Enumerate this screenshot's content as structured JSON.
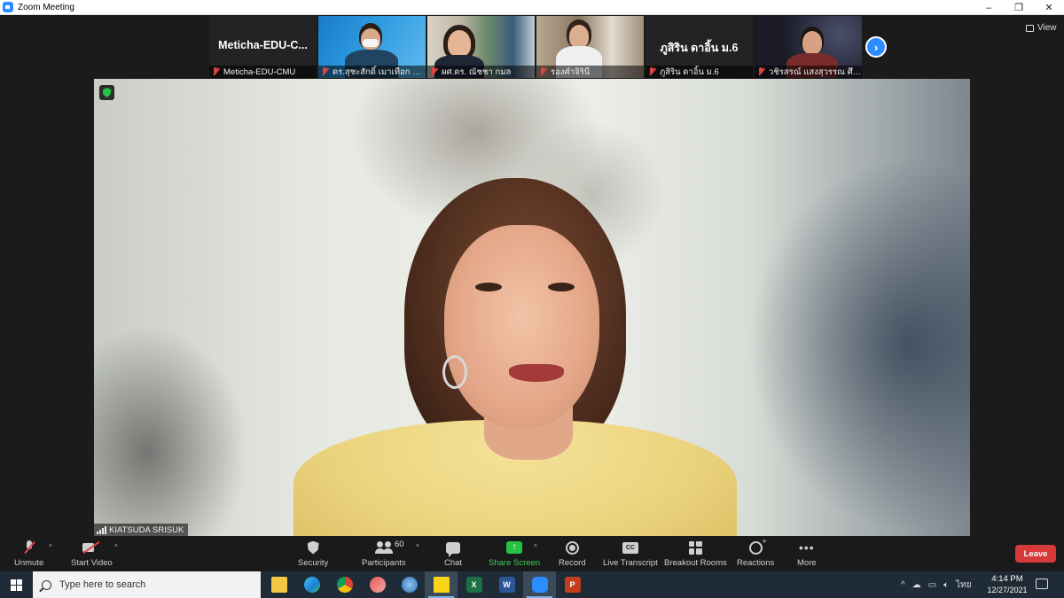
{
  "window": {
    "title": "Zoom Meeting",
    "controls": [
      "–",
      "❐",
      "✕"
    ]
  },
  "view_button": {
    "label": "View"
  },
  "thumbnails": [
    {
      "name": "Meticha-EDU-CMU",
      "display_name": "Meticha-EDU-C...",
      "muted": true,
      "video": false
    },
    {
      "name": "ดร.สุชะสักดิ์ เมาเทือก มห...",
      "muted": true,
      "video": true
    },
    {
      "name": "ผศ.ดร. ณัชชา กมล",
      "muted": true,
      "video": true
    },
    {
      "name": "รองคำจิรินี",
      "muted": true,
      "video": true
    },
    {
      "name": "ภูสิริน ดาอิ้น ม.6",
      "display_name": "ภูสิริน ดาอิ้น ม.6",
      "muted": true,
      "video": false
    },
    {
      "name": "วชิรสรณ์ แสงสุวรรณ ศึก...",
      "muted": true,
      "video": true
    }
  ],
  "speaker": {
    "name": "KIATSUDA SRISUK"
  },
  "toolbar": {
    "unmute": "Unmute",
    "start_video": "Start Video",
    "security": "Security",
    "participants": "Participants",
    "participants_count": "60",
    "chat": "Chat",
    "share_screen": "Share Screen",
    "record": "Record",
    "live_transcript": "Live Transcript",
    "breakout_rooms": "Breakout Rooms",
    "reactions": "Reactions",
    "more": "More",
    "leave": "Leave",
    "share_arrow": "↑",
    "cc": "CC",
    "more_dots": "•••"
  },
  "taskbar": {
    "search_placeholder": "Type here to search",
    "apps": [
      "file-explorer",
      "edge",
      "chrome",
      "snip",
      "browser",
      "sticky-notes",
      "excel",
      "word",
      "zoom",
      "powerpoint"
    ],
    "app_letters": {
      "excel": "X",
      "word": "W",
      "powerpoint": "P"
    },
    "language": "ไทย",
    "time": "4:14 PM",
    "date": "12/27/2021"
  },
  "colors": {
    "zoom_blue": "#2d8cff",
    "leave_red": "#d73a3a",
    "share_green": "#26c246",
    "muted_red": "#e04343"
  }
}
